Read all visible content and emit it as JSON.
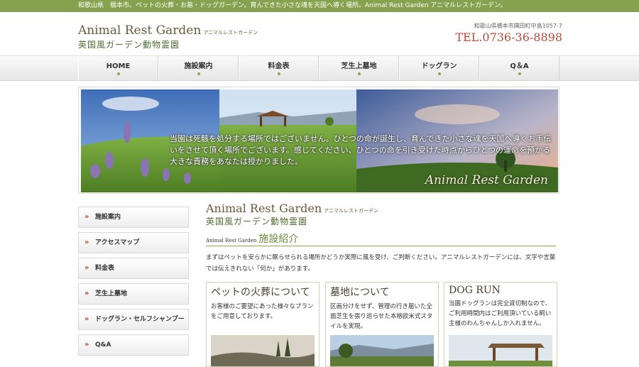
{
  "topbar": {
    "text": "和歌山県　橋本市。ペットの火葬・お墓・ドッグガーデン。育んできた小さな魂を天国へ導く場所。Animal Rest Garden アニマルレストガーデン。"
  },
  "header": {
    "logo_en": "Animal Rest Garden",
    "logo_en_kana": "アニマルレストガーデン",
    "logo_jp": "英国風ガーデン動物霊園",
    "address": "和歌山県橋本市隅田町中島1057-7",
    "tel": "TEL.0736-36-8898"
  },
  "nav": {
    "items": [
      "HOME",
      "施設案内",
      "料金表",
      "芝生上墓地",
      "ドッグラン",
      "Q＆A"
    ]
  },
  "hero": {
    "message": "当園は死骸を処分する場所ではございません。ひとつの命が誕生し、育んできた小さな魂を天国へ導くお手伝いをさせて頂く場所でございます。感じてください、ひとつの命を引き受けた時点からひとつの運命を預かる大きな責務をあなたは授かりました。",
    "brand": "Animal Rest Garden"
  },
  "sidebar": {
    "items": [
      "施設案内",
      "アクセスマップ",
      "料金表",
      "芝生上墓地",
      "ドッグラン・セルフシャンプー",
      "Q&A"
    ]
  },
  "main": {
    "logo_en": "Animal Rest Garden",
    "logo_en_kana": "アニマルレストガーデン",
    "logo_jp": "英国風ガーデン動物霊園",
    "section_sub": "Animal Rest Garden",
    "section_title": "施設紹介",
    "intro": "まずはペットを安らかに眠らせられる場所かどうか実際に風を受け、ご判断ください。アニマルレストガーデンには、文字や言葉では伝えきれない「何か」があります。",
    "cards": [
      {
        "title": "ペットの火葬について",
        "body": "お客様のご要望にあった様々なプランをご用意しております。"
      },
      {
        "title": "墓地について",
        "body": "区画分けをせず、管理の行き届いた全面芝生を張り巡らせた本格欧米式スタイルを実現。"
      },
      {
        "title": "DOG RUN",
        "body": "当園ドッグランは完全貸切制なので、ご利用時間内はご利用頂いている飼い主様のわんちゃんしか入れません。"
      }
    ]
  },
  "colors": {
    "accent_green": "#86a24e",
    "tel_red": "#b34a3a",
    "arrow_red": "#b24a32"
  }
}
